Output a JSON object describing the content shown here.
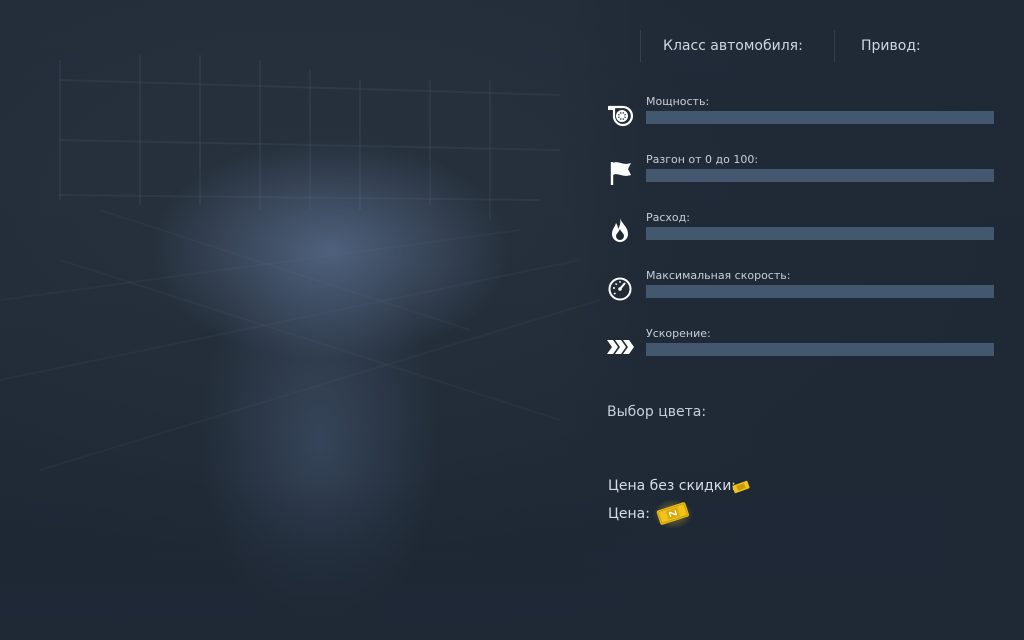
{
  "header": {
    "car_class_label": "Класс автомобиля:",
    "drive_label": "Привод:"
  },
  "stats": [
    {
      "icon": "turbo-icon",
      "label": "Мощность:",
      "fill_percent": 100
    },
    {
      "icon": "flag-icon",
      "label": "Разгон от 0 до 100:",
      "fill_percent": 100
    },
    {
      "icon": "flame-icon",
      "label": "Расход:",
      "fill_percent": 100
    },
    {
      "icon": "speedometer-icon",
      "label": "Максимальная скорость:",
      "fill_percent": 100
    },
    {
      "icon": "triple-chevron-icon",
      "label": "Ускорение:",
      "fill_percent": 100
    }
  ],
  "color_select": {
    "label": "Выбор цвета:"
  },
  "pricing": {
    "original_price_label": "Цена без скидки:",
    "price_label": "Цена:",
    "currency_icon": "gold-ticket-icon"
  },
  "colors": {
    "background": "#1f2936",
    "bar": "#43586f",
    "text": "#c6ced8",
    "ticket": "#f2c419"
  }
}
